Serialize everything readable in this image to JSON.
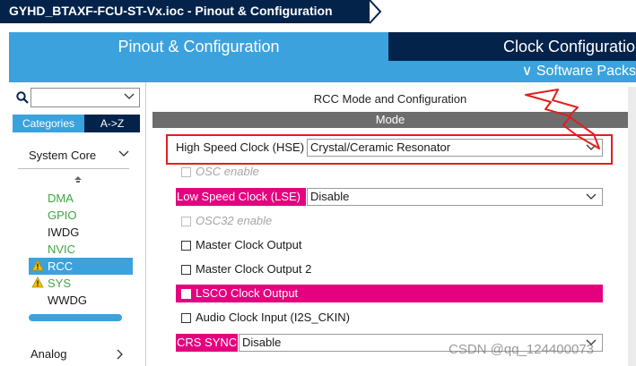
{
  "window": {
    "title": "GYHD_BTAXF-FCU-ST-Vx.ioc - Pinout & Configuration"
  },
  "tabs": {
    "pinout": "Pinout & Configuration",
    "clock": "Clock Configuration"
  },
  "subbar": {
    "software_packs": "∨ Software Packs"
  },
  "left_panel": {
    "search_value": "",
    "tab_categories": "Categories",
    "tab_az": "A->Z",
    "section_system_core": "System Core",
    "items": [
      {
        "label": "DMA",
        "color": "green",
        "warning": false
      },
      {
        "label": "GPIO",
        "color": "green",
        "warning": false
      },
      {
        "label": "IWDG",
        "color": "default",
        "warning": false
      },
      {
        "label": "NVIC",
        "color": "green",
        "warning": false
      },
      {
        "label": "RCC",
        "color": "selected",
        "warning": true
      },
      {
        "label": "SYS",
        "color": "green",
        "warning": true
      },
      {
        "label": "WWDG",
        "color": "default",
        "warning": false
      }
    ],
    "section_analog": "Analog"
  },
  "main": {
    "title": "RCC Mode and Configuration",
    "mode_header": "Mode",
    "hse": {
      "label": "High Speed Clock (HSE)",
      "value": "Crystal/Ceramic Resonator"
    },
    "osc_enable": "OSC enable",
    "lse": {
      "label": "Low Speed Clock (LSE)",
      "value": "Disable"
    },
    "osc32_enable": "OSC32 enable",
    "mco": "Master Clock Output",
    "mco2": "Master Clock Output 2",
    "lsco": "LSCO Clock Output",
    "audio": "Audio Clock Input (I2S_CKIN)",
    "crs": {
      "label": "CRS SYNC",
      "value": "Disable"
    }
  },
  "watermark": "CSDN @qq_124400073",
  "colors": {
    "navy": "#03234b",
    "blue": "#3ca2dd",
    "pink": "#e5007f",
    "green": "#3ea641",
    "highlight_red": "#e02020"
  }
}
